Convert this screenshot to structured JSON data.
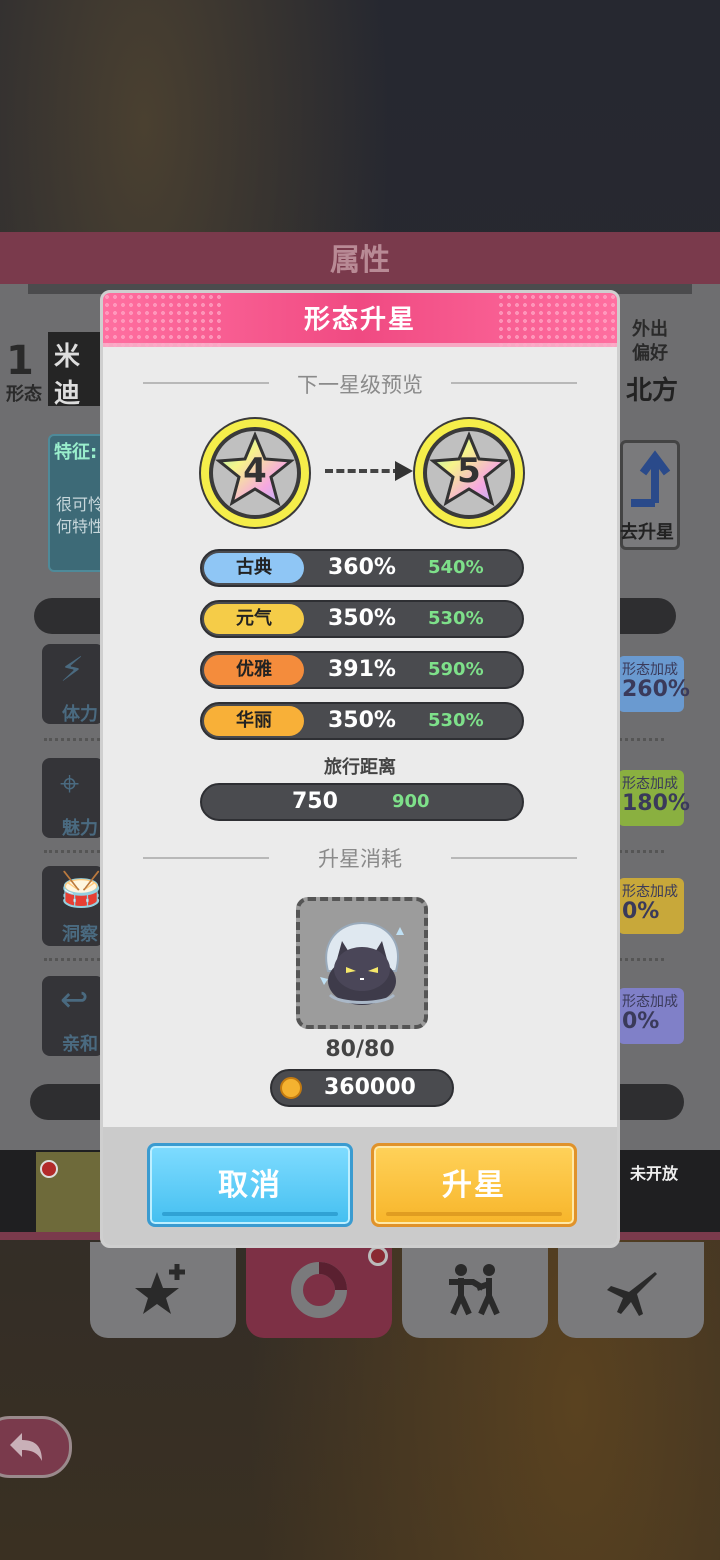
{
  "background": {
    "panel_title": "属性",
    "left_number": "1",
    "left_label": "形态",
    "name_text": "米迪",
    "feature_title": "特征:",
    "feature_desc": [
      "很可怜",
      "何特性"
    ],
    "right_top": [
      "外出",
      "偏好"
    ],
    "right_direction": "北方",
    "upgrade_label": "去升星",
    "stats": [
      {
        "label": "体力",
        "icon": "lightning-icon"
      },
      {
        "label": "魅力",
        "icon": "target-icon"
      },
      {
        "label": "洞察",
        "icon": "drum-icon"
      },
      {
        "label": "亲和",
        "icon": "handshake-icon"
      }
    ],
    "bonuses": [
      {
        "title": "形态加成",
        "value": "260%",
        "color": "#6a9ad0"
      },
      {
        "title": "形态加成",
        "value": "180%",
        "color": "#8ab040"
      },
      {
        "title": "形态加成",
        "value": "0%",
        "color": "#c8a83a"
      },
      {
        "title": "形态加成",
        "value": "0%",
        "color": "#8080c8"
      }
    ],
    "not_open": "未开放",
    "tabs": [
      {
        "name": "star-plus-icon"
      },
      {
        "name": "ring-chart-icon"
      },
      {
        "name": "fight-icon"
      },
      {
        "name": "airplane-icon"
      }
    ],
    "back_icon": "back-arrow-icon"
  },
  "modal": {
    "title": "形态升星",
    "preview_title": "下一星级预览",
    "current_star": "4",
    "next_star": "5",
    "stats": [
      {
        "label": "古典",
        "current": "360%",
        "next": "540%",
        "color": "#8fc6f5"
      },
      {
        "label": "元气",
        "current": "350%",
        "next": "530%",
        "color": "#f5cc48"
      },
      {
        "label": "优雅",
        "current": "391%",
        "next": "590%",
        "color": "#f48c3c"
      },
      {
        "label": "华丽",
        "current": "350%",
        "next": "530%",
        "color": "#f8b038"
      }
    ],
    "travel_label": "旅行距离",
    "travel_current": "750",
    "travel_next": "900",
    "cost_title": "升星消耗",
    "item_icon": "cat-character-icon",
    "item_count": "80/80",
    "coin_icon": "coin-icon",
    "coin_cost": "360000",
    "cancel_label": "取消",
    "confirm_label": "升星"
  }
}
